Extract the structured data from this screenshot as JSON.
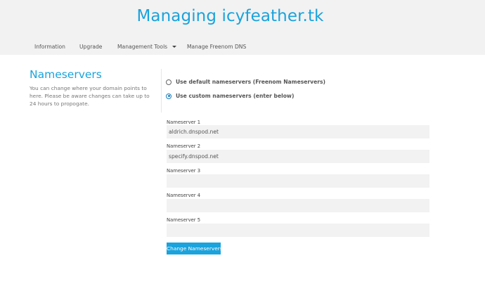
{
  "header": {
    "title": "Managing icyfeather.tk"
  },
  "nav": {
    "items": [
      {
        "label": "Information"
      },
      {
        "label": "Upgrade"
      },
      {
        "label": "Management Tools"
      },
      {
        "label": "Manage Freenom DNS"
      }
    ]
  },
  "nameservers": {
    "title": "Nameservers",
    "description": "You can change where your domain points to here. Please be aware changes can take up to 24 hours to propogate.",
    "options": [
      {
        "label": "Use default nameservers (Freenom Nameservers)",
        "checked": false
      },
      {
        "label": "Use custom nameservers (enter below)",
        "checked": true
      }
    ],
    "fields": [
      {
        "label": "Nameserver 1",
        "value": "aldrich.dnspod.net"
      },
      {
        "label": "Nameserver 2",
        "value": "specify.dnspod.net"
      },
      {
        "label": "Nameserver 3",
        "value": ""
      },
      {
        "label": "Nameserver 4",
        "value": ""
      },
      {
        "label": "Nameserver 5",
        "value": ""
      }
    ],
    "submit_label": "Change Nameservers"
  },
  "colors": {
    "accent": "#1aa3dc",
    "header_bg": "#f2f2f2",
    "field_bg": "#f2f2f2"
  },
  "icons": {
    "dropdown": "caret-down-icon",
    "radio_unchecked": "radio-unchecked-icon",
    "radio_checked": "radio-checked-icon"
  }
}
